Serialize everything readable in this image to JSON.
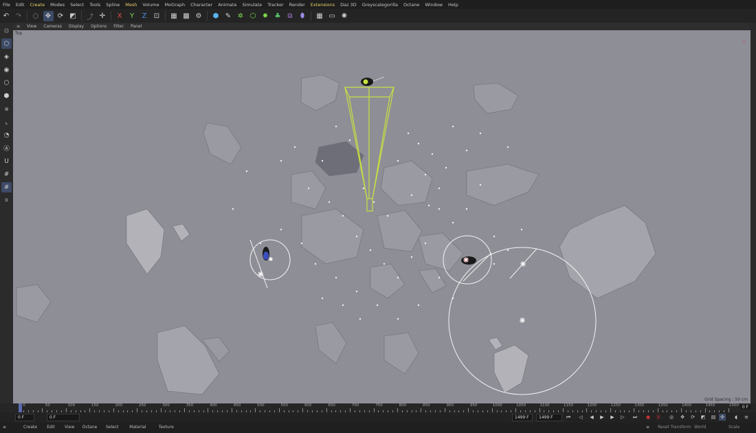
{
  "menubar": {
    "items": [
      "File",
      "Edit",
      "Create",
      "Modes",
      "Select",
      "Tools",
      "Spline",
      "Mesh",
      "Volume",
      "MoGraph",
      "Character",
      "Animate",
      "Simulate",
      "Tracker",
      "Render",
      "Extensions",
      "Daz 3D",
      "Greyscalegorilla",
      "Octane",
      "Window",
      "Help"
    ]
  },
  "toolbar": {
    "icons": [
      "undo-icon",
      "redo-icon",
      "live-select-icon",
      "move-icon",
      "rotate-icon",
      "scale-icon",
      "recent-tool-icon",
      "transform-icon",
      "x-axis-icon",
      "y-axis-icon",
      "z-axis-icon",
      "world-coord-icon",
      "clapper-icon",
      "render-view-icon",
      "render-settings-icon",
      "cube-icon",
      "pen-icon",
      "subdivision-icon",
      "cloner-icon",
      "mograph-icon",
      "deformer-icon",
      "environment-icon",
      "grid-icon",
      "camera-icon",
      "light-icon"
    ],
    "axis_labels": [
      "X",
      "Y",
      "Z"
    ]
  },
  "viewport_menu": [
    "View",
    "Cameras",
    "Display",
    "Options",
    "Filter",
    "Panel"
  ],
  "viewport": {
    "view_name": "Top",
    "grid_spacing": "Grid Spacing : 50 cm",
    "background": "#8e8e97"
  },
  "timeline": {
    "ticks": [
      "0",
      "50",
      "100",
      "150",
      "200",
      "250",
      "300",
      "350",
      "400",
      "450",
      "500",
      "550",
      "600",
      "650",
      "700",
      "750",
      "800",
      "850",
      "900",
      "950",
      "1000",
      "1050",
      "1100",
      "1150",
      "1200",
      "1250",
      "1300",
      "1350",
      "1400",
      "1450",
      "1500"
    ],
    "current_frame_right": "0 F",
    "min": 0,
    "max": 1500
  },
  "transport": {
    "start": "0 F",
    "current": "0 F",
    "end_a": "1499 F",
    "end_b": "1499 F"
  },
  "bottombar": {
    "menu": [
      "Create",
      "Edit",
      "View",
      "Octane",
      "Select",
      "Material",
      "Texture"
    ],
    "reset_transform": "Reset Transform",
    "coord": "World",
    "mode": "Scale"
  },
  "colors": {
    "accent": "#e8d36a",
    "active_tool": "#3d4a66",
    "camera_frustum": "#c8e040",
    "record": "#d03030"
  }
}
